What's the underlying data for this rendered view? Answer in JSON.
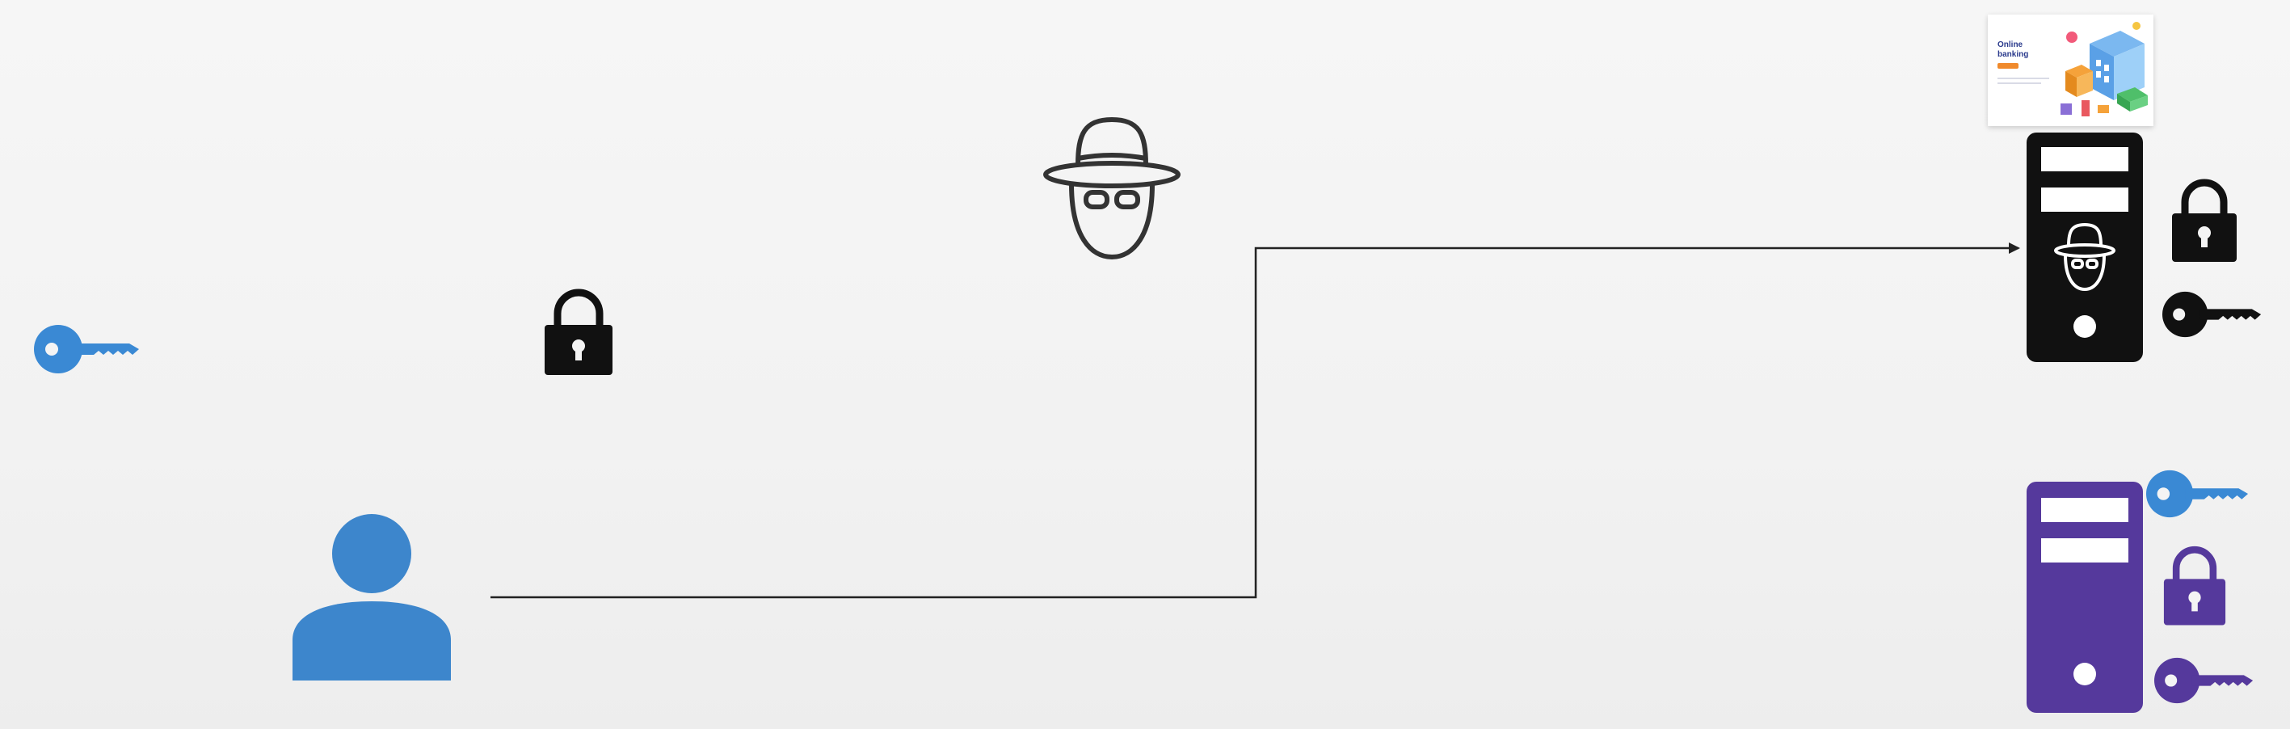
{
  "diagram": {
    "website_card": {
      "title": "Online banking"
    },
    "icons": [
      "key-icon",
      "lock-icon",
      "user-icon",
      "hacker-icon",
      "server-icon",
      "website-preview"
    ]
  },
  "colors": {
    "background": "#f4f4f4",
    "user_blue": "#3d86cc",
    "key_blue": "#3a89d4",
    "server_black": "#111111",
    "server_purple": "#55399c",
    "hacker_outline": "#333333",
    "connection_line": "#222222"
  }
}
